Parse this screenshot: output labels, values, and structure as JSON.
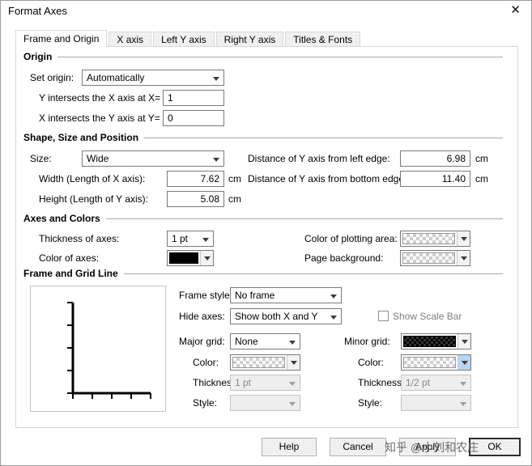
{
  "window": {
    "title": "Format Axes",
    "close_glyph": "✕"
  },
  "tabs": [
    {
      "label": "Frame and Origin",
      "active": true
    },
    {
      "label": "X axis",
      "active": false
    },
    {
      "label": "Left Y axis",
      "active": false
    },
    {
      "label": "Right Y axis",
      "active": false
    },
    {
      "label": "Titles & Fonts",
      "active": false
    }
  ],
  "origin": {
    "header": "Origin",
    "set_origin_label": "Set origin:",
    "set_origin_value": "Automatically",
    "y_label": "Y intersects the X axis at X=",
    "y_value": "1",
    "x_label": "X intersects the Y axis at Y=",
    "x_value": "0"
  },
  "shape": {
    "header": "Shape, Size and Position",
    "size_label": "Size:",
    "size_value": "Wide",
    "width_label": "Width (Length of X axis):",
    "width_value": "7.62",
    "height_label": "Height (Length of Y axis):",
    "height_value": "5.08",
    "dist_left_label": "Distance of Y axis from left edge:",
    "dist_left_value": "6.98",
    "dist_bottom_label": "Distance of Y axis from bottom edge:",
    "dist_bottom_value": "11.40",
    "unit": "cm"
  },
  "axes_colors": {
    "header": "Axes and Colors",
    "thickness_label": "Thickness of axes:",
    "thickness_value": "1 pt",
    "color_axes_label": "Color of axes:",
    "color_axes_swatch": "black",
    "plot_area_label": "Color of plotting area:",
    "plot_area_swatch": "transparent-checker",
    "page_bg_label": "Page background:",
    "page_bg_swatch": "transparent-checker"
  },
  "frame_grid": {
    "header": "Frame and Grid Line",
    "frame_style_label": "Frame style:",
    "frame_style_value": "No frame",
    "hide_axes_label": "Hide axes:",
    "hide_axes_value": "Show both X and Y",
    "scale_bar_label": "Show Scale Bar",
    "scale_bar_checked": false,
    "major_grid_label": "Major grid:",
    "major_grid_value": "None",
    "minor_grid_label": "Minor grid:",
    "minor_grid_swatch": "black-pattern",
    "color_label": "Color:",
    "major_color_swatch": "transparent-checker",
    "minor_color_swatch": "transparent-checker",
    "thickness_label": "Thickness:",
    "major_thickness_value": "1 pt",
    "minor_thickness_value": "1/2 pt",
    "style_label": "Style:"
  },
  "buttons": {
    "help": "Help",
    "cancel": "Cancel",
    "apply": "Apply",
    "ok": "OK"
  },
  "watermark": "知乎 @小刘和农庄",
  "colors": {
    "axes": "#000000",
    "highlight": "#b8d6f0"
  }
}
